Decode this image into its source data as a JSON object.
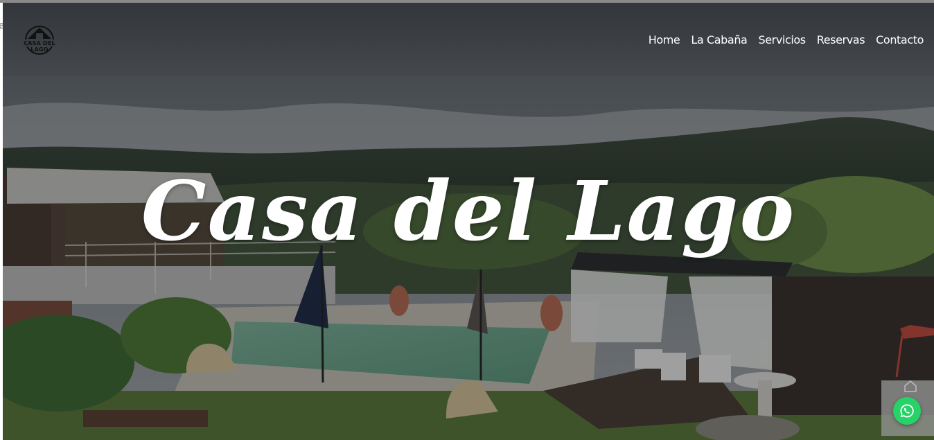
{
  "header": {
    "logo_text": "CASA DEL LAGO",
    "nav": [
      {
        "label": "Home"
      },
      {
        "label": "La Cabaña"
      },
      {
        "label": "Servicios"
      },
      {
        "label": "Reservas"
      },
      {
        "label": "Contacto"
      }
    ]
  },
  "hero": {
    "title": "Casa del Lago"
  },
  "icons": {
    "whatsapp": "whatsapp-icon",
    "logo": "cabin-logo-icon",
    "scroll_top": "home-icon"
  },
  "colors": {
    "header_bg": "#3a3e42",
    "nav_text": "#ffffff",
    "whatsapp": "#25d366"
  }
}
